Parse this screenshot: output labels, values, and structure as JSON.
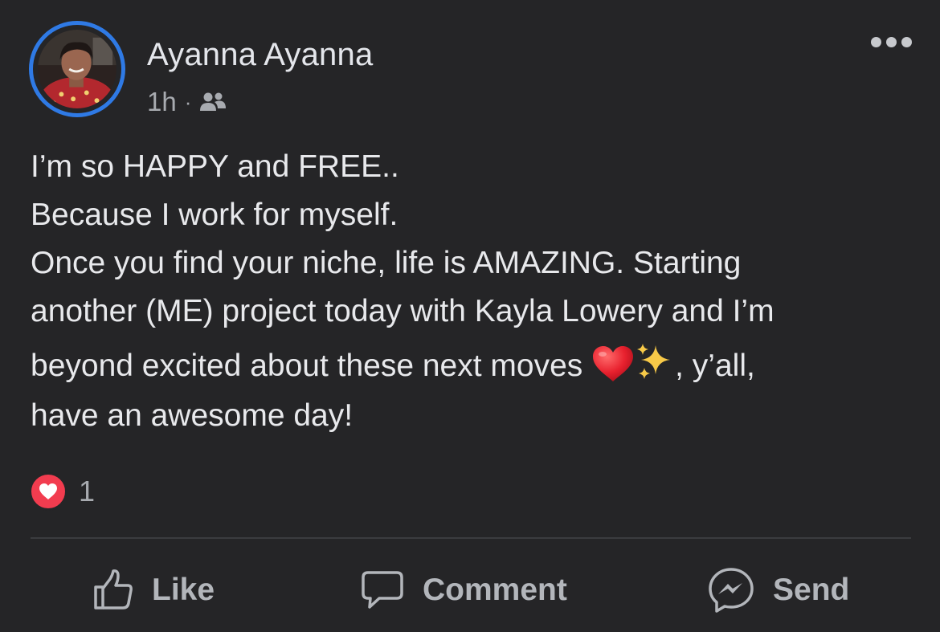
{
  "post": {
    "author": "Ayanna Ayanna",
    "time": "1h",
    "separator": "·",
    "audience_icon": "friends-icon",
    "lines": [
      "I’m so HAPPY and FREE..",
      "Because I work for myself.",
      "Once you find your niche, life is AMAZING. Starting",
      "another (ME) project today with Kayla Lowery and I’m"
    ],
    "line5_text": "beyond excited about these next moves ",
    "line5_suffix": ", y’all,",
    "line6": "have an awesome day!",
    "emojis": [
      "red-heart",
      "sparkles"
    ]
  },
  "reactions": {
    "type": "love",
    "count": "1"
  },
  "actions": {
    "like_label": "Like",
    "comment_label": "Comment",
    "send_label": "Send"
  },
  "colors": {
    "background": "#252527",
    "avatar_ring": "#2f7ae5",
    "love": "#f23c4f",
    "text": "#e8e9ec",
    "secondary_text": "#a8abb0"
  }
}
